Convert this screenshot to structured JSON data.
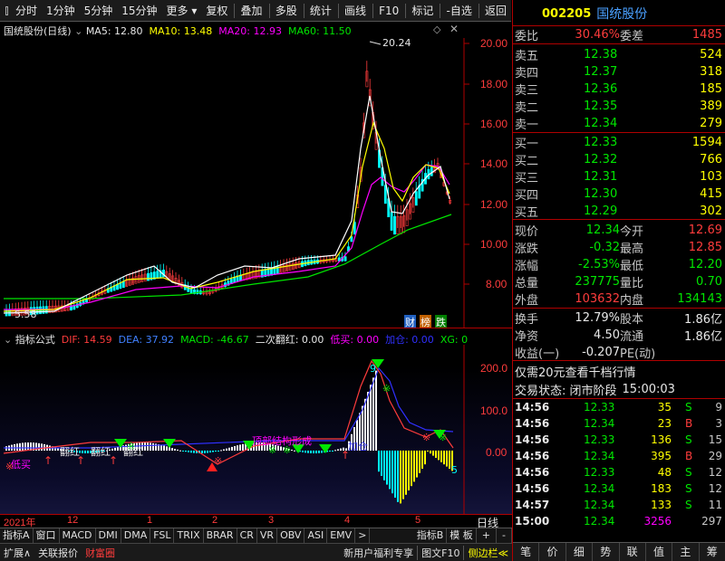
{
  "toolbar": {
    "left_items": [
      "分时",
      "1分钟",
      "5分钟",
      "15分钟",
      "更多"
    ],
    "right_items": [
      "复权",
      "叠加",
      "多股",
      "统计",
      "画线",
      "F10",
      "标记",
      "-自选",
      "返回"
    ]
  },
  "main_chart": {
    "title": "国统股份(日线)",
    "ma5": "MA5: 12.80",
    "ma10": "MA10: 13.48",
    "ma20": "MA20: 12.93",
    "ma60": "MA60: 11.50",
    "high_marker": "20.24",
    "low_marker": "5.58",
    "y_ticks": [
      "20.00",
      "18.00",
      "16.00",
      "14.00",
      "12.00",
      "10.00",
      "8.00"
    ],
    "badges": [
      "财",
      "榜",
      "跌"
    ],
    "colors": {
      "ma5": "#ffffff",
      "ma10": "#ffff00",
      "ma20": "#ff00ff",
      "ma60": "#00ff00",
      "up": "#ff3c3c",
      "down": "#00ffff"
    }
  },
  "indicator": {
    "title": "指标公式",
    "dif": "DIF: 14.59",
    "dea": "DEA: 37.92",
    "macd": "MACD: -46.67",
    "flip": "二次翻红: 0.00",
    "low_buy": "低买: 0.00",
    "add_pos": "加仓: 0.00",
    "xg": "XG: 0",
    "y_ticks": [
      "200.0",
      "100.0",
      "0.00"
    ],
    "annotations": {
      "low_buy": "低买",
      "flip_red_1": "翻红",
      "flip_red_2": "翻红",
      "flip_red_3": "翻红",
      "top_structure": "顶部结构形成",
      "add_pos": "加仓",
      "marker_9": "9",
      "marker_5": "5"
    }
  },
  "x_axis": {
    "labels": [
      "2021年",
      "12",
      "1",
      "2",
      "3",
      "4",
      "5"
    ],
    "right_label": "日线"
  },
  "bottom_tabs": [
    "指标A",
    "窗口",
    "MACD",
    "DMI",
    "DMA",
    "FSL",
    "TRIX",
    "BRAR",
    "CR",
    "VR",
    "OBV",
    "ASI",
    "EMV",
    ">",
    "指标B",
    "模 板",
    "+",
    "-"
  ],
  "status_bar": {
    "expand": "扩展∧",
    "related": "关联报价",
    "wealth": "财富圈",
    "welfare": "新用户福利专享",
    "graph": "图文F10",
    "sidebar": "侧边栏≪"
  },
  "quote": {
    "code": "002205",
    "name": "国统股份",
    "weibi_label": "委比",
    "weibi_value": "30.46%",
    "weicha_label": "委差",
    "weicha_value": "1485",
    "asks": [
      {
        "label": "卖五",
        "price": "12.38",
        "vol": "524"
      },
      {
        "label": "卖四",
        "price": "12.37",
        "vol": "318"
      },
      {
        "label": "卖三",
        "price": "12.36",
        "vol": "185"
      },
      {
        "label": "卖二",
        "price": "12.35",
        "vol": "389"
      },
      {
        "label": "卖一",
        "price": "12.34",
        "vol": "279"
      }
    ],
    "bids": [
      {
        "label": "买一",
        "price": "12.33",
        "vol": "1594"
      },
      {
        "label": "买二",
        "price": "12.32",
        "vol": "766"
      },
      {
        "label": "买三",
        "price": "12.31",
        "vol": "103"
      },
      {
        "label": "买四",
        "price": "12.30",
        "vol": "415"
      },
      {
        "label": "买五",
        "price": "12.29",
        "vol": "302"
      }
    ],
    "stats": [
      {
        "l1": "现价",
        "v1": "12.34",
        "l2": "今开",
        "v2": "12.69"
      },
      {
        "l1": "涨跌",
        "v1": "-0.32",
        "l2": "最高",
        "v2": "12.85"
      },
      {
        "l1": "涨幅",
        "v1": "-2.53%",
        "l2": "最低",
        "v2": "12.20"
      },
      {
        "l1": "总量",
        "v1": "237775",
        "l2": "量比",
        "v2": "0.70"
      },
      {
        "l1": "外盘",
        "v1": "103632",
        "l2": "内盘",
        "v2": "134143"
      }
    ],
    "stats2": [
      {
        "l1": "换手",
        "v1": "12.79%",
        "l2": "股本",
        "v2": "1.86亿"
      },
      {
        "l1": "净资",
        "v1": "4.50",
        "l2": "流通",
        "v2": "1.86亿"
      },
      {
        "l1": "收益(一)",
        "v1": "-0.207",
        "l2": "PE(动)",
        "v2": ""
      }
    ],
    "promo": "仅需20元查看千档行情",
    "trade_status_label": "交易状态: 闭市阶段",
    "trade_status_time": "15:00:03",
    "ticks": [
      {
        "time": "14:56",
        "price": "12.33",
        "vol": "35",
        "dir": "S",
        "n": "9"
      },
      {
        "time": "14:56",
        "price": "12.34",
        "vol": "23",
        "dir": "B",
        "n": "3"
      },
      {
        "time": "14:56",
        "price": "12.33",
        "vol": "136",
        "dir": "S",
        "n": "15"
      },
      {
        "time": "14:56",
        "price": "12.34",
        "vol": "395",
        "dir": "B",
        "n": "29"
      },
      {
        "time": "14:56",
        "price": "12.33",
        "vol": "48",
        "dir": "S",
        "n": "12"
      },
      {
        "time": "14:56",
        "price": "12.34",
        "vol": "183",
        "dir": "S",
        "n": "12"
      },
      {
        "time": "14:57",
        "price": "12.34",
        "vol": "133",
        "dir": "S",
        "n": "11"
      },
      {
        "time": "15:00",
        "price": "12.34",
        "vol": "3256",
        "dir": "",
        "n": "297"
      }
    ],
    "tabs": [
      "笔",
      "价",
      "细",
      "势",
      "联",
      "值",
      "主",
      "筹"
    ]
  }
}
